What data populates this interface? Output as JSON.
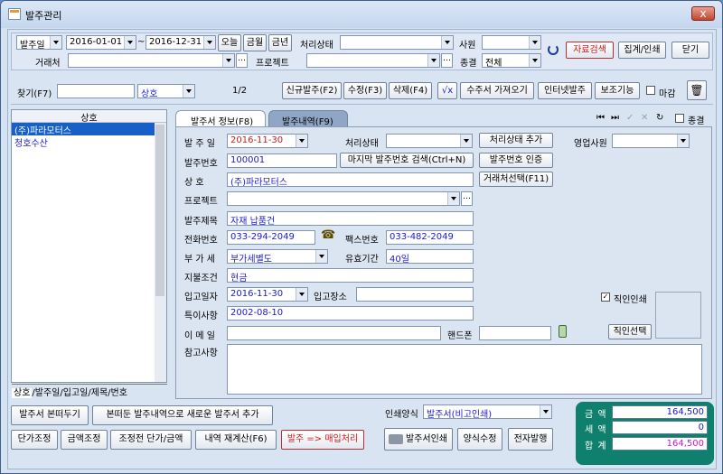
{
  "window": {
    "title": "발주관리",
    "close": "x"
  },
  "toolbar": {
    "date_type": "발주일",
    "date_from": "2016-01-01",
    "tilde": "~",
    "date_to": "2016-12-31",
    "today": "오늘",
    "this_month": "금월",
    "this_year": "금년",
    "status_label": "처리상태",
    "status_value": "",
    "staff_label": "사원",
    "staff_value": "",
    "search": "자료검색",
    "summary_print": "집계/인쇄",
    "close": "닫기",
    "vendor_label": "거래처",
    "vendor_value": "",
    "project_label": "프로젝트",
    "project_value": "",
    "end_label": "종결",
    "end_value": "전체"
  },
  "findbar": {
    "find_label": "찾기(F7)",
    "find_value": "",
    "find_field": "상호",
    "page": "1/2",
    "new": "신규발주(F2)",
    "edit": "수정(F3)",
    "delete": "삭제(F4)",
    "calc": "√x",
    "import": "수주서 가져오기",
    "internet": "인터넷발주",
    "assist": "보조기능",
    "closing": "마감"
  },
  "list": {
    "header": "상호",
    "items": [
      "(주)파라모터스",
      "청호수산"
    ],
    "selected": 0,
    "tabs": [
      "상호",
      "발주일",
      "입고일",
      "제목",
      "번호"
    ]
  },
  "tabs": {
    "info": "발주서 정보(F8)",
    "detail": "발주내역(F9)",
    "end_label": "종결"
  },
  "form": {
    "order_date_label": "발 주 일",
    "order_date": "2016-11-30",
    "status_label": "처리상태",
    "status_value": "",
    "add_status": "처리상태 추가",
    "sales_label": "영업사원",
    "sales_value": "",
    "order_no_label": "발주번호",
    "order_no": "100001",
    "last_no_search": "마지막 발주번호 검색(Ctrl+N)",
    "auth_no": "발주번호 인증",
    "company_label": "상    호",
    "company": "(주)파라모터스",
    "select_vendor": "거래처선택(F11)",
    "project_label": "프로젝트",
    "project": "",
    "subject_label": "발주제목",
    "subject": "자재 납품건",
    "phone_label": "전화번호",
    "phone": "033-294-2049",
    "fax_label": "팩스번호",
    "fax": "033-482-2049",
    "vat_label": "부 가 세",
    "vat": "부가세별도",
    "valid_label": "유효기간",
    "valid": "40일",
    "payment_label": "지불조건",
    "payment": "현금",
    "in_date_label": "입고일자",
    "in_date": "2016-11-30",
    "in_place_label": "입고장소",
    "in_place": "",
    "special_label": "특이사항",
    "special": "2002-08-10",
    "email_label": "이 메 일",
    "email": "",
    "mobile_label": "핸드폰",
    "mobile": "",
    "seal_label": "직인인쇄",
    "seal_select": "직인선택",
    "memo_label": "참고사항",
    "memo": ""
  },
  "bottom": {
    "copy_order": "발주서 본떠두기",
    "copy_new": "본떠둔 발주내역으로 새로운 발주서 추가",
    "unit_adjust": "단가조정",
    "amount_adjust": "금액조정",
    "pre_adjust": "조정전 단가/금액",
    "recalc": "내역 재계산(F6)",
    "to_purchase": "발주 => 매입처리",
    "print_form_label": "인쇄양식",
    "print_form": "발주서(비고인쇄)",
    "print": "발주서인쇄",
    "form_edit": "양식수정",
    "e_issue": "전자발행"
  },
  "totals": {
    "amount_label": "금  액",
    "amount": "164,500",
    "tax_label": "세  액",
    "tax": "0",
    "total_label": "합  계",
    "total": "164,500"
  }
}
